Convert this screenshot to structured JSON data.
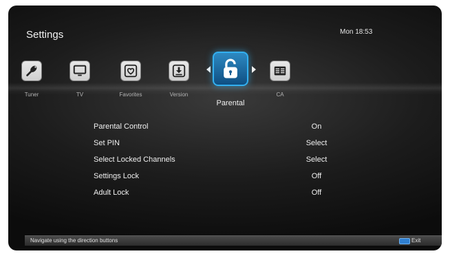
{
  "header": {
    "title": "Settings",
    "clock": "Mon 18:53"
  },
  "tabs": [
    {
      "id": "tuner",
      "label": "Tuner",
      "icon": "satellite-dish-icon"
    },
    {
      "id": "tv",
      "label": "TV",
      "icon": "tv-icon"
    },
    {
      "id": "favorites",
      "label": "Favorites",
      "icon": "heart-icon"
    },
    {
      "id": "version",
      "label": "Version",
      "icon": "download-icon"
    },
    {
      "id": "parental",
      "label": "Parental",
      "icon": "unlocked-padlock-icon",
      "selected": true
    },
    {
      "id": "ca",
      "label": "CA",
      "icon": "card-icon"
    }
  ],
  "menu": [
    {
      "label": "Parental Control",
      "value": "On"
    },
    {
      "label": "Set PIN",
      "value": "Select"
    },
    {
      "label": "Select Locked Channels",
      "value": "Select"
    },
    {
      "label": "Settings Lock",
      "value": "Off"
    },
    {
      "label": "Adult Lock",
      "value": "Off"
    }
  ],
  "footer": {
    "hint": "Navigate using the direction buttons",
    "exit_label": "Exit"
  },
  "colors": {
    "selection": "#33b0f0",
    "exit_key": "#2f7fd0"
  }
}
